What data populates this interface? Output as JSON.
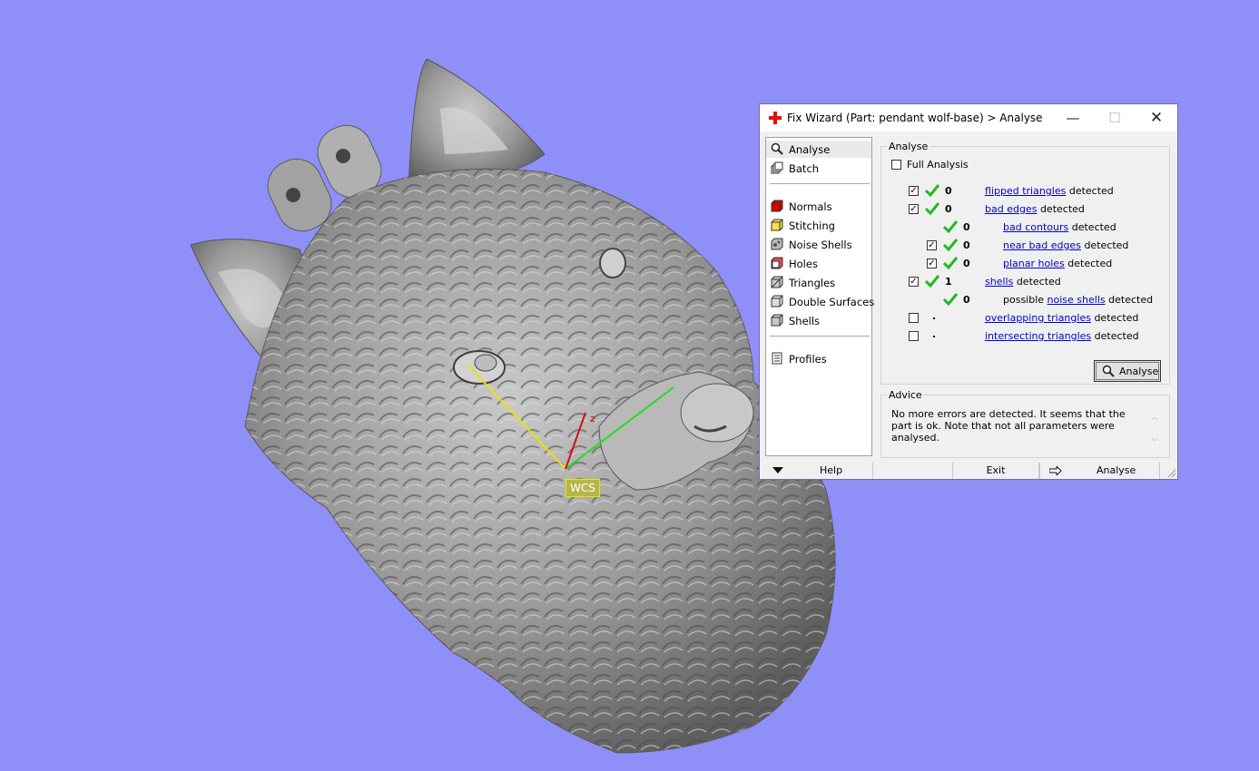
{
  "viewport": {
    "axis_labels": {
      "z": "z",
      "wcs": "WCS"
    },
    "colors": {
      "background": "#8f8ff8",
      "x_axis": "#22dd22",
      "y_axis": "#f0e000",
      "z_axis": "#cc1111"
    }
  },
  "dialog": {
    "title": "Fix Wizard (Part: pendant wolf-base) > Analyse",
    "window_buttons": {
      "minimize": "—",
      "maximize": "☐",
      "close": "✕"
    },
    "nav": {
      "items": [
        {
          "label": "Analyse",
          "icon": "magnifier-icon"
        },
        {
          "label": "Batch",
          "icon": "batch-icon"
        },
        {
          "label": "Normals",
          "icon": "normals-cube-icon"
        },
        {
          "label": "Stitching",
          "icon": "stitching-cube-icon"
        },
        {
          "label": "Noise Shells",
          "icon": "noise-shells-icon"
        },
        {
          "label": "Holes",
          "icon": "holes-cube-icon"
        },
        {
          "label": "Triangles",
          "icon": "triangles-cube-icon"
        },
        {
          "label": "Double Surfaces",
          "icon": "double-surfaces-icon"
        },
        {
          "label": "Shells",
          "icon": "shells-cube-icon"
        },
        {
          "label": "Profiles",
          "icon": "profiles-icon"
        }
      ]
    },
    "analyse_group": {
      "legend": "Analyse",
      "full_analysis_label": "Full Analysis",
      "full_analysis_checked": false,
      "detected_word": "detected",
      "possible_word": "possible",
      "rows": [
        {
          "checked": true,
          "ok": true,
          "count": "0",
          "link": "flipped triangles"
        },
        {
          "checked": true,
          "ok": true,
          "count": "0",
          "link": "bad edges"
        },
        {
          "checked": null,
          "ok": true,
          "count": "0",
          "link": "bad contours"
        },
        {
          "checked": true,
          "ok": true,
          "count": "0",
          "link": "near bad edges"
        },
        {
          "checked": true,
          "ok": true,
          "count": "0",
          "link": "planar holes"
        },
        {
          "checked": true,
          "ok": true,
          "count": "1",
          "link": "shells"
        },
        {
          "checked": null,
          "ok": true,
          "count": "0",
          "link": "noise shells"
        },
        {
          "checked": false,
          "ok": false,
          "count": ".",
          "link": "overlapping triangles"
        },
        {
          "checked": false,
          "ok": false,
          "count": ".",
          "link": "intersecting triangles"
        }
      ],
      "analyse_button": "Analyse"
    },
    "advice_group": {
      "legend": "Advice",
      "text": "No more errors are detected. It seems that the part is ok. Note that not all parameters were analysed."
    },
    "bottom": {
      "help": "Help",
      "exit": "Exit",
      "analyse": "Analyse"
    }
  }
}
